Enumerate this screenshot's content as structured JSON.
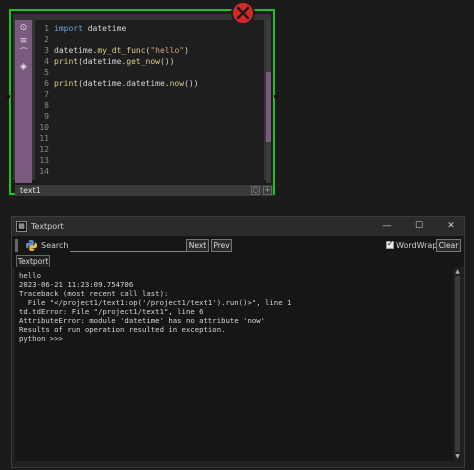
{
  "node": {
    "name": "text1",
    "error_indicator": "error-x-icon",
    "code_lines": [
      {
        "num": "1",
        "tokens": [
          {
            "t": "import",
            "c": "kw"
          },
          {
            "t": " datetime",
            "c": ""
          }
        ]
      },
      {
        "num": "2",
        "tokens": []
      },
      {
        "num": "3",
        "tokens": [
          {
            "t": "datetime.",
            "c": ""
          },
          {
            "t": "my_dt_func",
            "c": "fn"
          },
          {
            "t": "(",
            "c": ""
          },
          {
            "t": "\"hello\"",
            "c": "str"
          },
          {
            "t": ")",
            "c": ""
          }
        ]
      },
      {
        "num": "4",
        "tokens": [
          {
            "t": "print",
            "c": "fn"
          },
          {
            "t": "(datetime.",
            "c": ""
          },
          {
            "t": "get_now",
            "c": "fn"
          },
          {
            "t": "())",
            "c": ""
          }
        ]
      },
      {
        "num": "5",
        "tokens": []
      },
      {
        "num": "6",
        "tokens": [
          {
            "t": "print",
            "c": "fn"
          },
          {
            "t": "(datetime.datetime.",
            "c": ""
          },
          {
            "t": "now",
            "c": "fn"
          },
          {
            "t": "())",
            "c": ""
          }
        ]
      },
      {
        "num": "7",
        "tokens": []
      },
      {
        "num": "8",
        "tokens": []
      },
      {
        "num": "9",
        "tokens": []
      },
      {
        "num": "10",
        "tokens": []
      },
      {
        "num": "11",
        "tokens": []
      },
      {
        "num": "12",
        "tokens": []
      },
      {
        "num": "13",
        "tokens": []
      },
      {
        "num": "14",
        "tokens": []
      }
    ],
    "colors": {
      "border": "#17c617",
      "viewer_strip": "#7a5a7f",
      "keyword": "#6ea3e0",
      "function": "#dcd28a",
      "string": "#d6a37a",
      "error": "#d42a25"
    }
  },
  "textport": {
    "title": "Textport",
    "window_buttons": {
      "minimize": "—",
      "maximize": "☐",
      "close": "✕"
    },
    "toolbar": {
      "search_label": "Search",
      "search_value": "",
      "next_label": "Next",
      "prev_label": "Prev",
      "wordwrap_label": "WordWrap",
      "wordwrap_checked": true,
      "clear_label": "Clear"
    },
    "tab_label": "Textport",
    "output_lines": [
      "hello",
      "2023-06-21 11:23:09.754706",
      "Traceback (most recent call last):",
      "  File \"</project1/text1:op('/project1/text1').run()>\", line 1",
      "td.tdError: File \"/project1/text1\", line 6",
      "AttributeError: module 'datetime' has no attribute 'now'",
      "Results of run operation resulted in exception.",
      "python >>>"
    ]
  }
}
